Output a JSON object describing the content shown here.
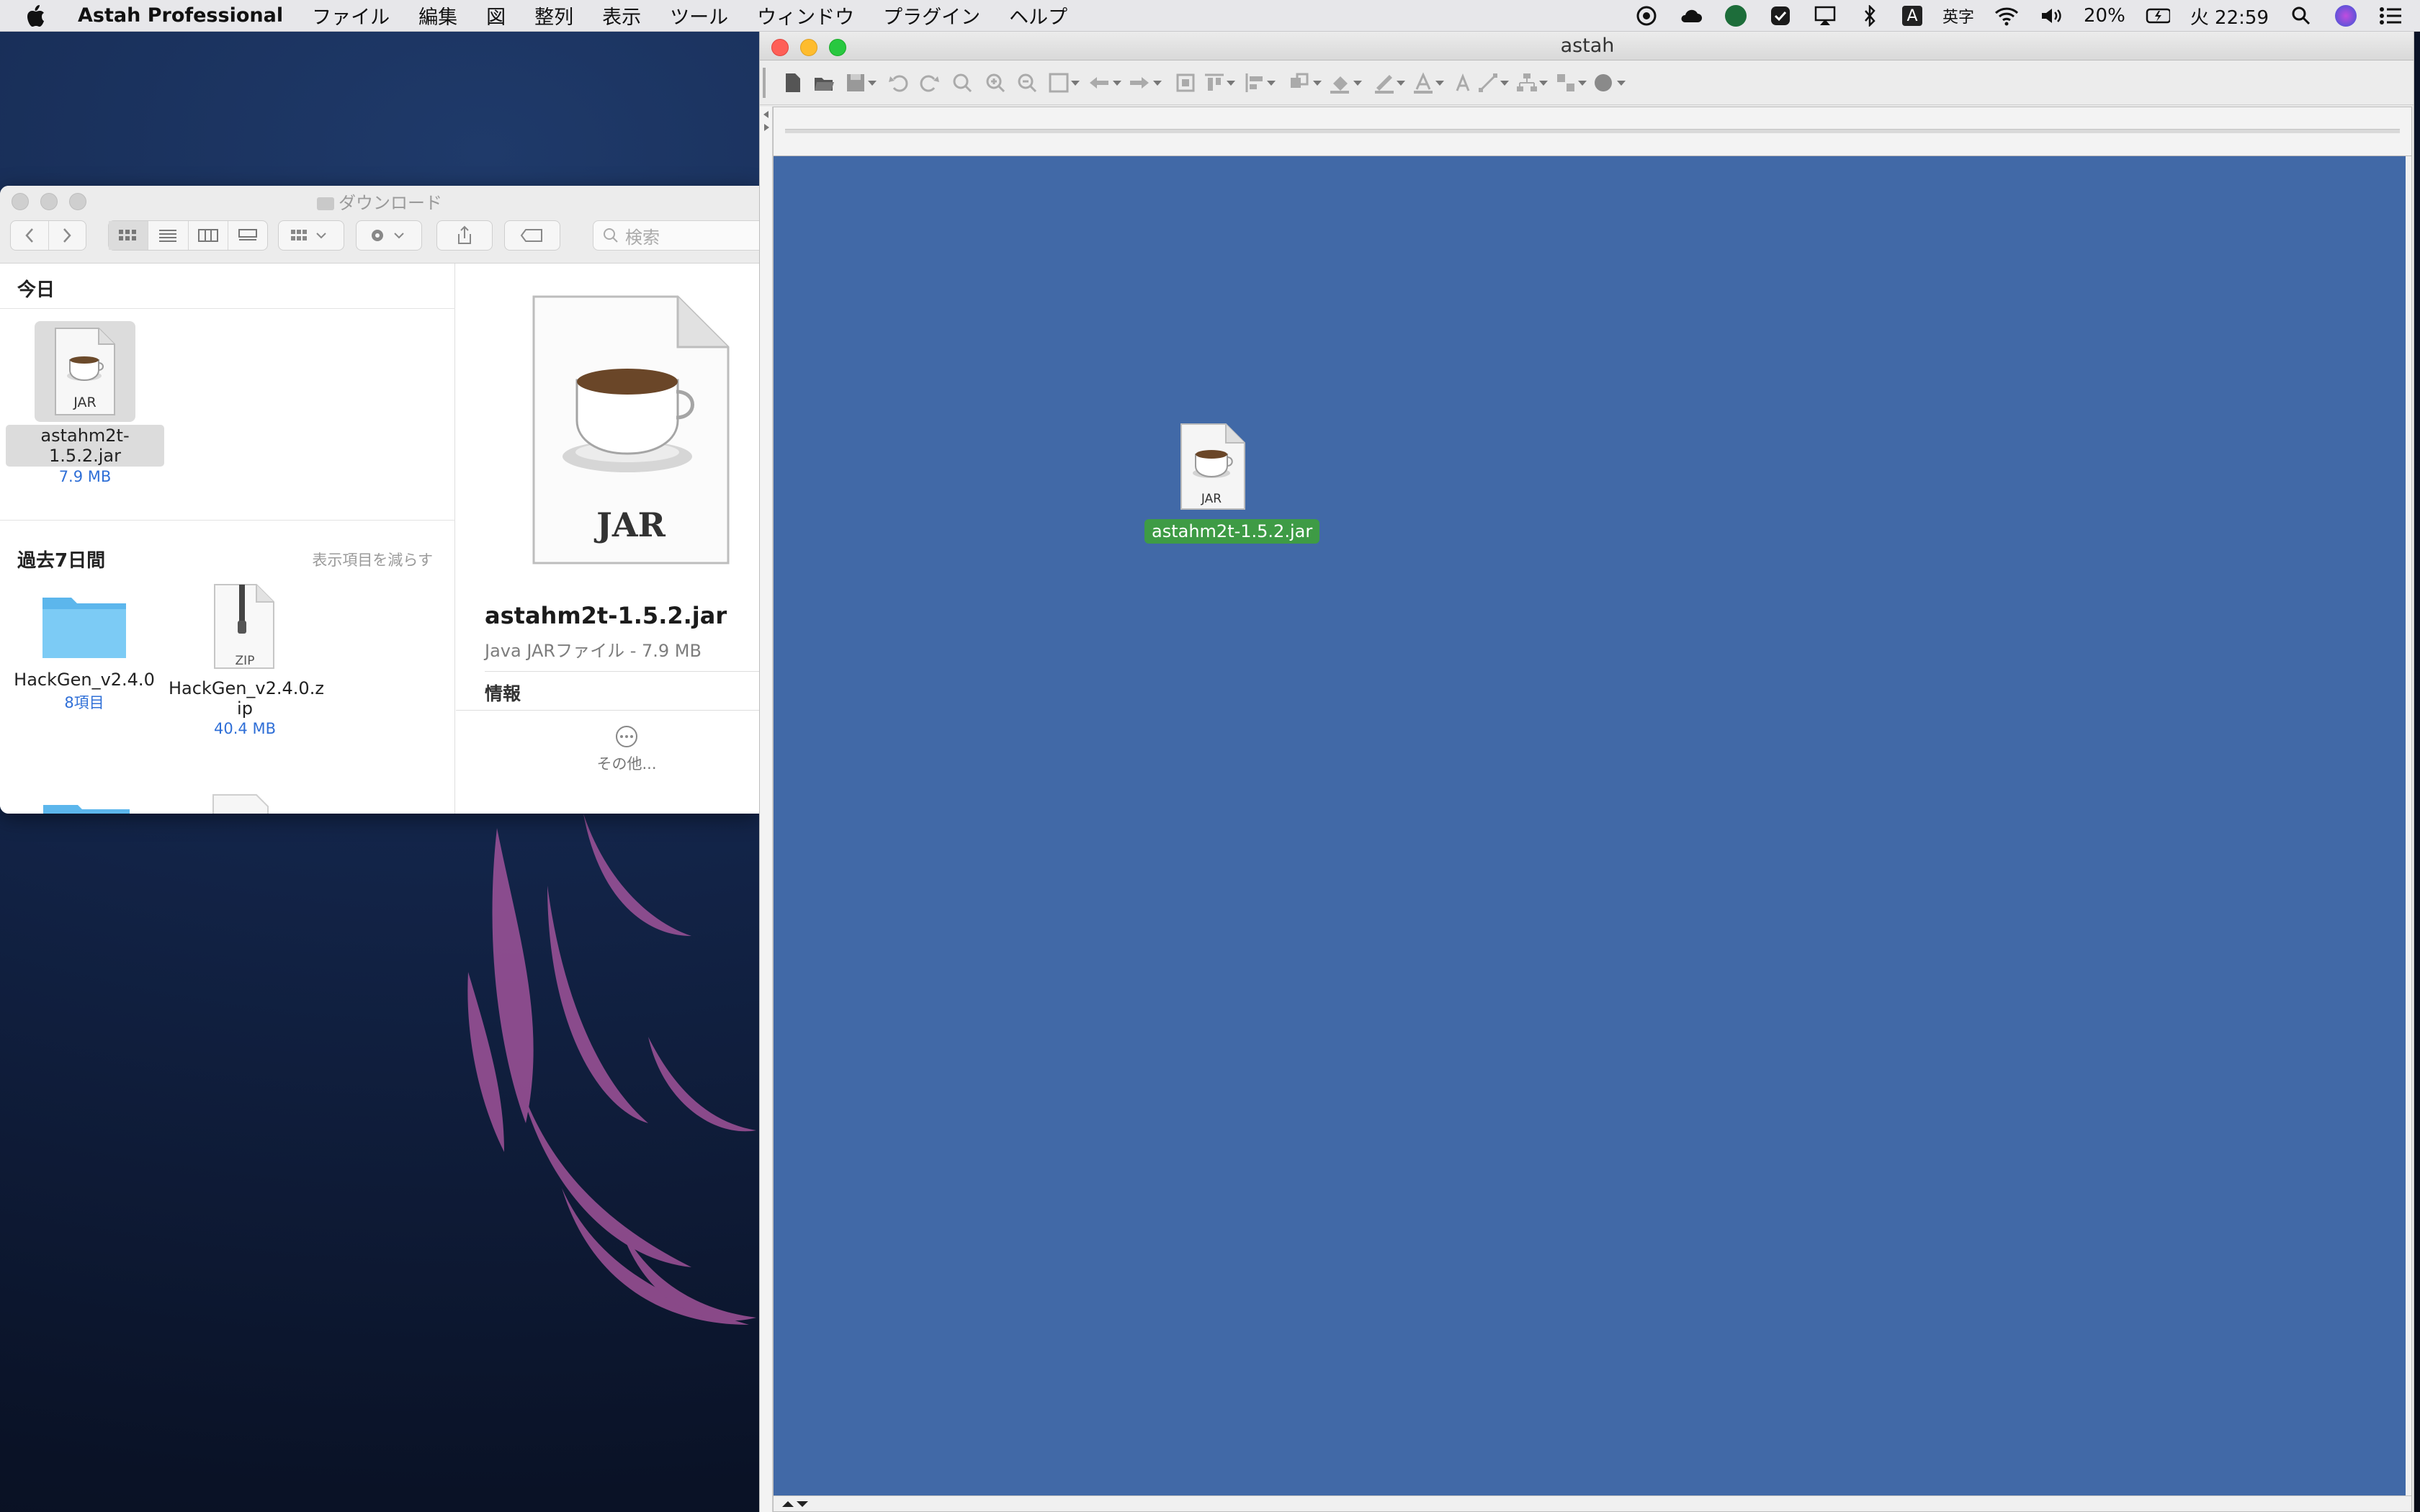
{
  "menubar": {
    "app_name": "Astah Professional",
    "items": [
      "ファイル",
      "編集",
      "図",
      "整列",
      "表示",
      "ツール",
      "ウィンドウ",
      "プラグイン",
      "ヘルプ"
    ],
    "input_mode_letter": "A",
    "input_mode_label": "英字",
    "battery": "20%",
    "clock": "火 22:59"
  },
  "finder": {
    "title": "ダウンロード",
    "search_placeholder": "検索",
    "section_today": "今日",
    "section_week": "過去7日間",
    "show_less": "表示項目を減らす",
    "today_items": [
      {
        "name": "astahm2t-1.5.2.jar",
        "sub": "7.9 MB",
        "badge": "JAR"
      }
    ],
    "week_items": [
      {
        "name": "HackGen_v2.4.0",
        "sub": "8項目"
      },
      {
        "name": "HackGen_v2.4.0.z",
        "name2": "ip",
        "sub": "40.4 MB",
        "badge": "ZIP"
      }
    ],
    "preview": {
      "badge": "JAR",
      "name": "astahm2t-1.5.2.jar",
      "kind": "Java JARファイル - 7.9 MB",
      "info": "情報",
      "more": "その他..."
    }
  },
  "astah": {
    "title": "astah",
    "canvas_color": "#4169a7",
    "dropped_file": {
      "badge": "JAR",
      "label": "astahm2t-1.5.2.jar"
    }
  }
}
